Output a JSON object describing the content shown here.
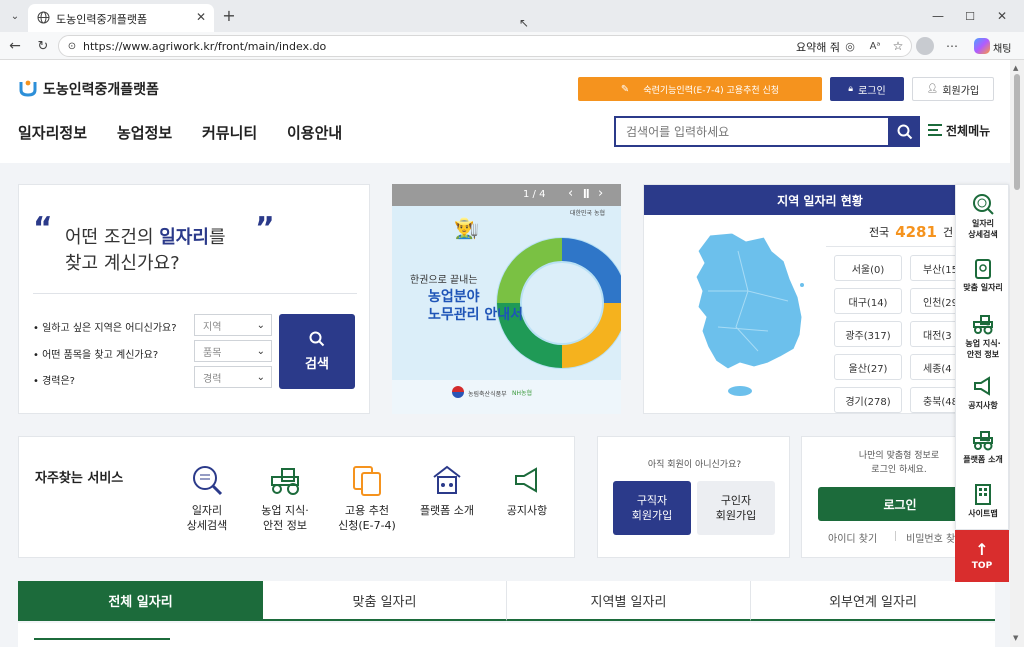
{
  "browser": {
    "tab_title": "도농인력중개플랫폼",
    "url": "https://www.agriwork.kr/front/main/index.do",
    "summarize_label": "요약해 줘",
    "chat_label": "채팅"
  },
  "header": {
    "logo_text": "도농인력중개플랫폼",
    "skilled_worker_button": "숙련기능인력(E-7-4) 고용추천 신청",
    "login_button": "로그인",
    "signup_button": "회원가입",
    "nav": [
      "일자리정보",
      "농업정보",
      "커뮤니티",
      "이용안내"
    ],
    "search_placeholder": "검색어를 입력하세요",
    "all_menu_label": "전체메뉴"
  },
  "search_card": {
    "line1_a": "어떤 조건의 ",
    "line1_b": "일자리",
    "line1_c": "를",
    "line2": "찾고 계신가요?",
    "q1": "• 일하고 싶은 지역은 어디신가요?",
    "q2": "• 어떤 품목을 찾고 계신가요?",
    "q3": "• 경력은?",
    "sel1": "지역",
    "sel2": "품목",
    "sel3": "경력",
    "search_button": "검색"
  },
  "banner": {
    "counter": "1 / 4",
    "top_right": "대한민국 농협",
    "line1": "한권으로 끝내는",
    "line2": "농업분야",
    "line3": "노무관리 안내서",
    "footer_left": "농림축산식품부",
    "footer_right": "NH농협"
  },
  "region": {
    "title": "지역 일자리 현황",
    "total_label": "전국",
    "total_count": "4281",
    "total_unit": "건",
    "buttons": [
      "서울(0)",
      "부산(15",
      "대구(14)",
      "인천(29",
      "광주(317)",
      "대전(3",
      "울산(27)",
      "세종(4",
      "경기(278)",
      "충북(48"
    ]
  },
  "services": {
    "title": "자주찾는 서비스",
    "items": [
      {
        "line1": "일자리",
        "line2": "상세검색"
      },
      {
        "line1": "농업 지식·",
        "line2": "안전 정보"
      },
      {
        "line1": "고용 추천",
        "line2": "신청(E-7-4)"
      },
      {
        "line1": "플랫폼 소개",
        "line2": ""
      },
      {
        "line1": "공지사항",
        "line2": ""
      }
    ]
  },
  "member_card": {
    "question": "아직 회원이 아니신가요?",
    "seeker_l1": "구직자",
    "seeker_l2": "회원가입",
    "employer_l1": "구인자",
    "employer_l2": "회원가입"
  },
  "login_card": {
    "line1": "나만의 맞춤형 정보로",
    "line2": "로그인 하세요.",
    "login_button": "로그인",
    "find_id": "아이디 찾기",
    "find_pw": "비밀번호 찾"
  },
  "job_tabs": [
    "전체 일자리",
    "맞춤 일자리",
    "지역별 일자리",
    "외부연계 일자리"
  ],
  "quick_menu": [
    {
      "line1": "일자리",
      "line2": "상세검색"
    },
    {
      "line1": "맞춤 일자리",
      "line2": ""
    },
    {
      "line1": "농업 지식·",
      "line2": "안전 정보"
    },
    {
      "line1": "공지사항",
      "line2": ""
    },
    {
      "line1": "플랫폼 소개",
      "line2": ""
    },
    {
      "line1": "사이트맵",
      "line2": ""
    }
  ],
  "top_button": "TOP",
  "colors": {
    "brand_green": "#1c6b3b",
    "navy": "#2b3a8a",
    "orange": "#f5931e",
    "map_blue": "#6cc0ec",
    "top_red": "#d92d2d"
  }
}
